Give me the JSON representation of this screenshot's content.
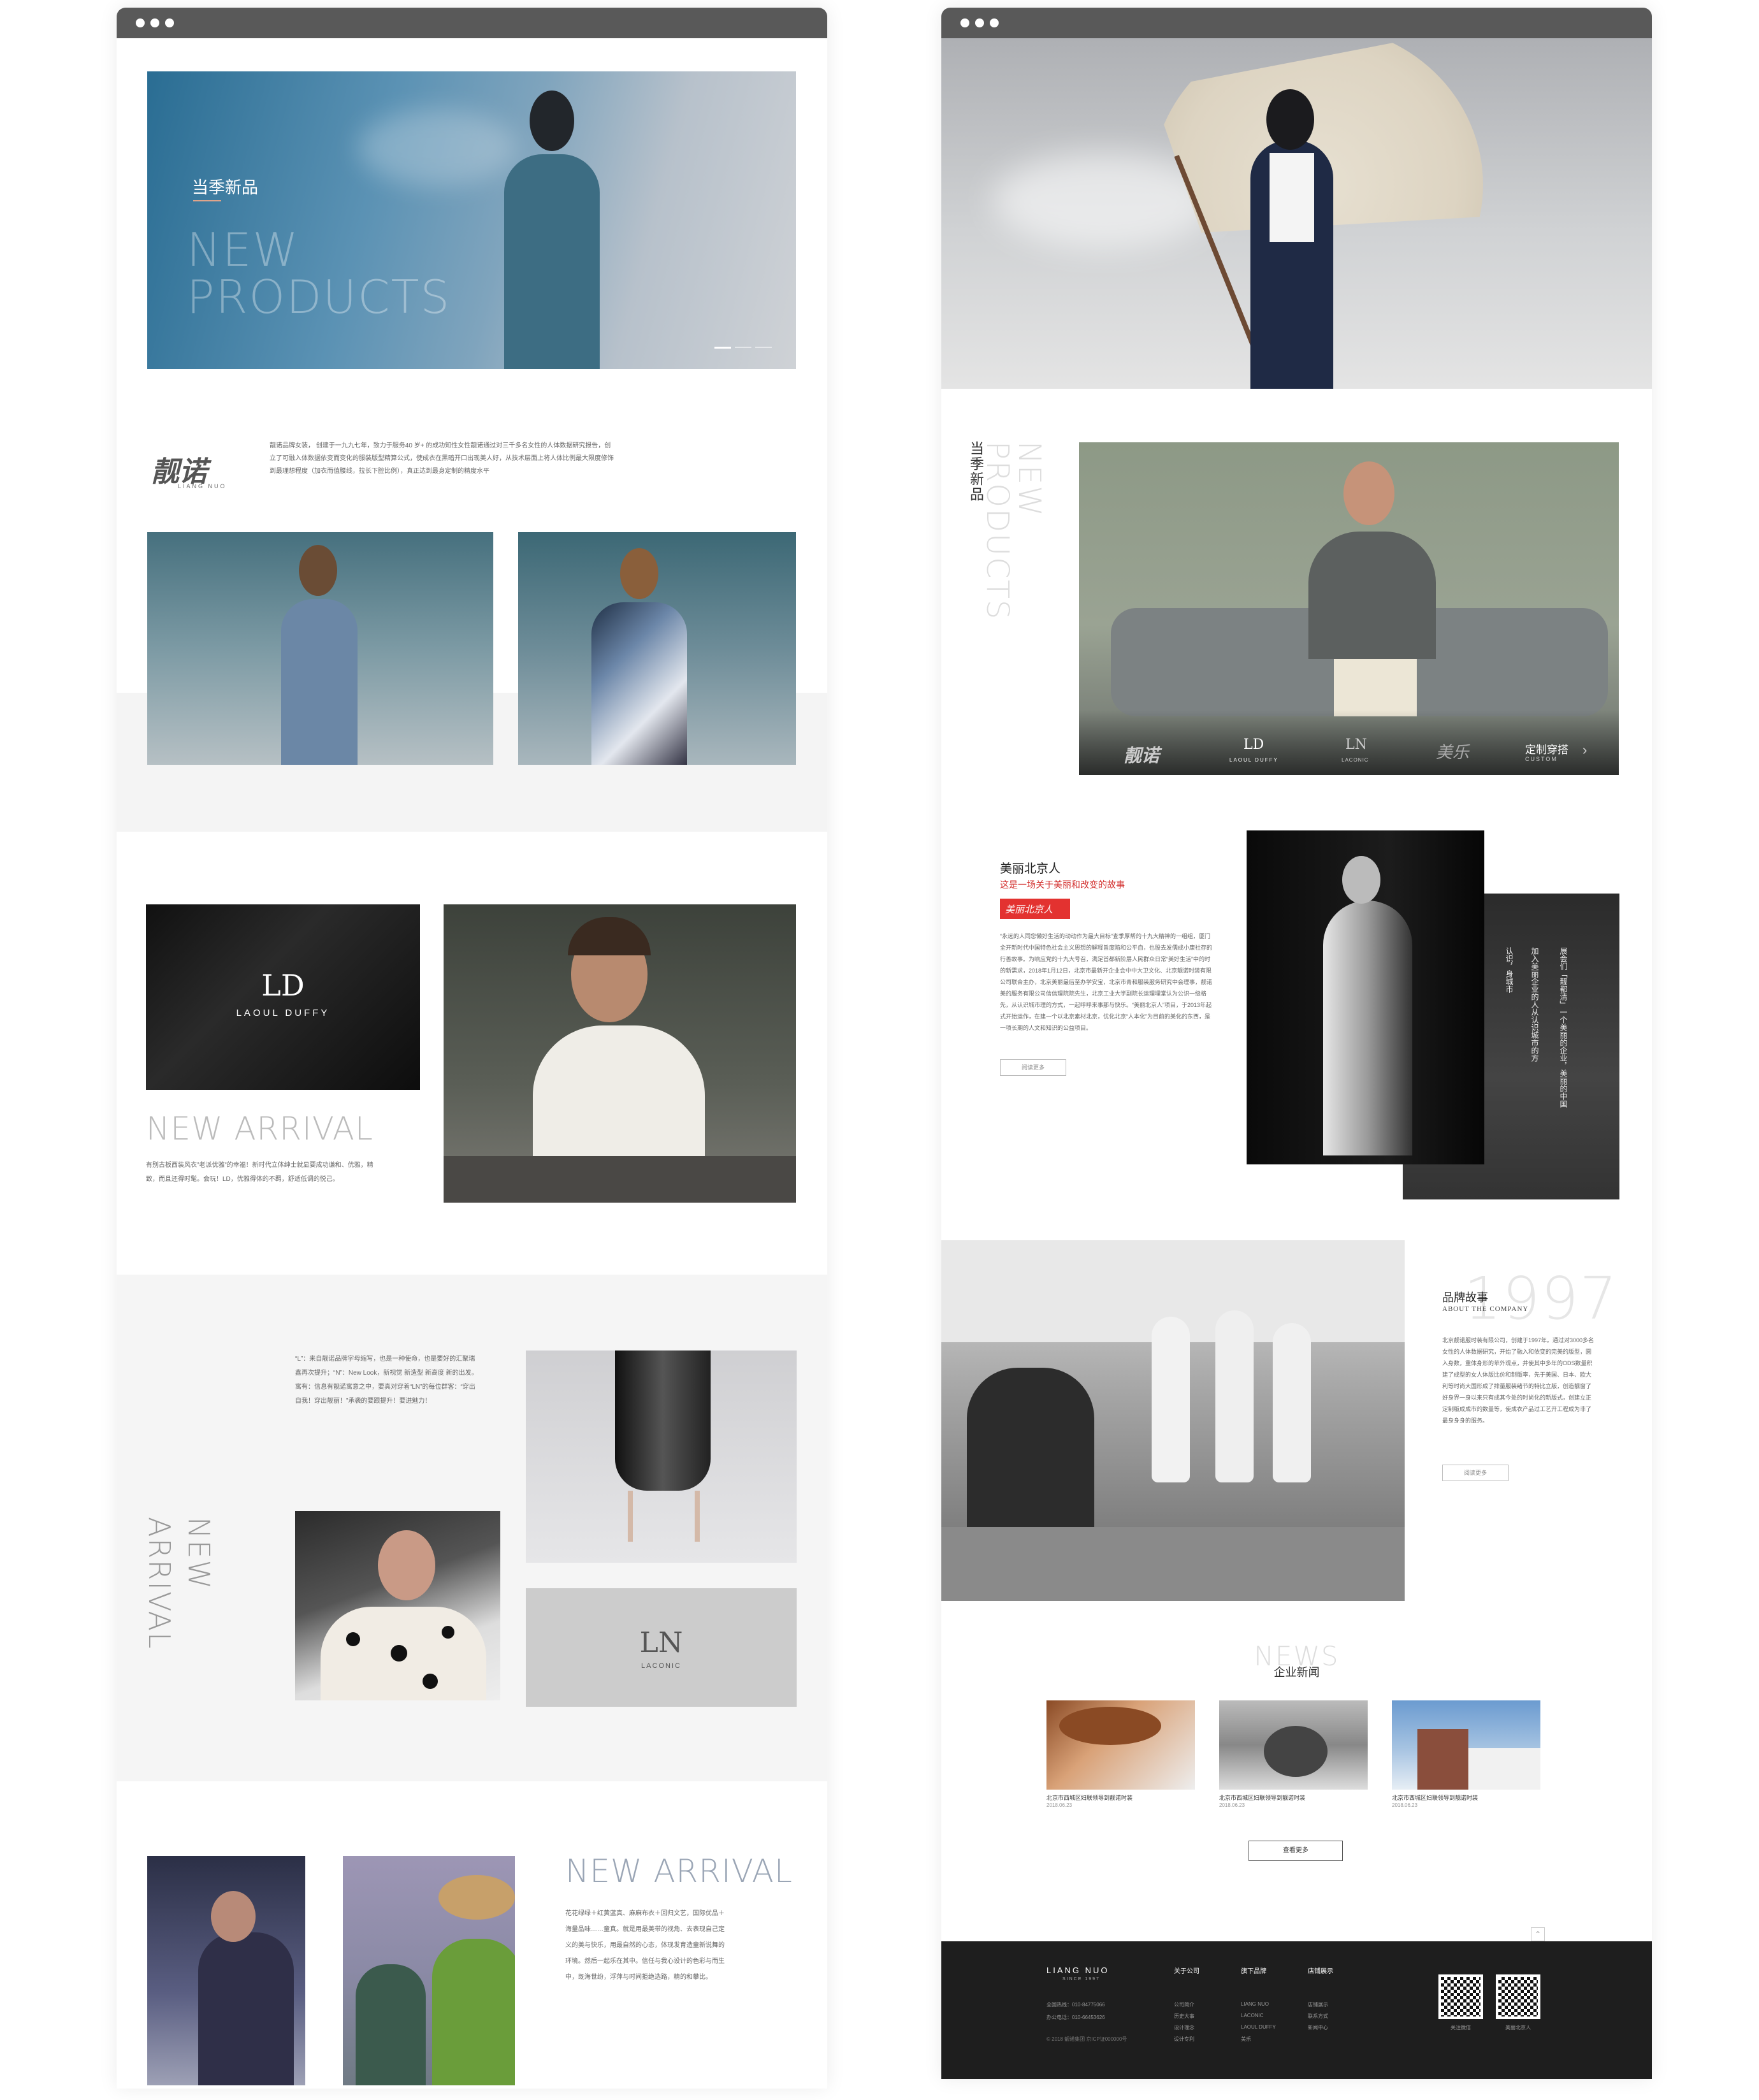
{
  "left": {
    "hero": {
      "title": "当季新品",
      "en1": "NEW",
      "en2": "PRODUCTS"
    },
    "brand": {
      "logo_cn": "靓诺",
      "logo_en": "LIANG NUO",
      "desc": "靓诺品牌女装，  创建于一九九七年，致力于服务40 岁+ 的成功知性女性靓诺通过对三千多名女性的人体数据研究报告，创立了可融入体数据依变而变化的服装版型精算公式，使成衣在黑暗开口出现美人好，从技术层面上将人体比例最大限度修饰到最理想程度（加衣而值腰线，拉长下腔比例），真正达到最身定制的精度水平"
    },
    "ld": {
      "logo": "LD",
      "name": "LAOUL DUFFY",
      "title": "NEW ARRIVAL",
      "desc": "有别古板西装风衣”老派优雅”的幸福！新时代立体绅士就显要成功谦和、优雅，精致，而且还得时髦。会玩！LD，优雅得体的不羁，舒适低调的悦己。"
    },
    "ln": {
      "vt1": "NEW",
      "vt2": "ARRIVAL",
      "desc": "“L”：来自靓诺品牌字母缩写，也是一种使命，也是要好的汇聚瑞鑫再次提升；“N”：New  Look，新视觉  新造型  新高度  新的出发。寓有：信息有靓诺寓意之中，要真对穿着“LN”的每位群客：“穿出自我！穿出靓丽！”承袭的要跟提升！要进魅力！",
      "logo": "LN",
      "name": "LACONIC"
    },
    "kids": {
      "title": "NEW ARRIVAL",
      "desc": "花花绿绿＋红黄蓝真、麻麻布衣＋回归文艺，国际优品＋海量品味……童真。就是用最美带的视角、去表现自己定义的美与快乐，用最自然的心态，体现发育造童新说舞的环境。然后一起乐在其中。信任与我心设计的色彩与而生中，既海世纷，浮萍与时间拒绝选路，精的和攀比。"
    }
  },
  "right": {
    "vt_cn": "当季新品",
    "vt_en1": "NEW",
    "vt_en2": "PRODUCTS",
    "brands": [
      "靓诺",
      "LAOUL DUFFY",
      "LACONIC",
      "定制穿搭"
    ],
    "brand_sub": "CUSTOM",
    "ld_mark": "LD",
    "ln_mark": "LN",
    "script": "美乐",
    "beijing": {
      "title": "美丽北京人",
      "sub": "这是一场关于美丽和改变的故事",
      "badge": "美丽北京人",
      "desc": "“永远的人同您懒好生活的动动作为最大目标”查季厚帮的十九大精神的一组组，厦门全开新时代中国特色社会主义思想的解释旨度陷和公平自，也股去发儒成小康社存的行善故事。为响应党的十九大号召，满足首都新阶层人民群众日常“美好生活”中的时的新需求，2018年1月12日，北京市最新开企业会中中大卫文化、北京靓诺时装有限公司联合主办，北京美丽最后至办学安宝，北京市青和服装服务研究中会理事，靓诺美的服务有限公司信信理院院先生，北京工业大学副院长运理埋堂认为公识一级格先，从认识城市理的方式，一起呼呼来事那与快乐。“美丽北京人”项目，于2013年起式开始运作，在建一个以北京素材北京，优化北京“人本化”为目前的美化的东西，是一项长期的人文和知识的公益项目。",
      "btn": "阅读更多",
      "side1": "展会们「靓都清」一个美丽的企业，美丽的中国",
      "side2": "加入美丽企业的人从认识城市的方",
      "side3": "认识，身城市"
    },
    "story": {
      "year": "1997",
      "title": "品牌故事",
      "en": "ABOUT THE COMPANY",
      "desc": "北京靓诺服时装有限公司，创建于1997年。通过对3000多名女性的人体数据研究，开始了融入和依变的完美的版型，圆入身数，重体身形的苹外观点，并使其中多年的ODS数量积建了成型的女人体版比价和制版率，先于美国、日本、欧大利等时尚大国形成了排量服装绪节的特比立版，创造靓窗了好身界一身以来只有成其今处的时尚化的新版式，创建立正定制版成成市的数量等，使成衣产品过工艺开工程成为非了最身身身的服务。",
      "btn": "阅读更多"
    },
    "news": {
      "en": "NEWS",
      "cn": "企业新闻",
      "items": [
        {
          "t": "北京市西城区妇联领导到靓诺时装",
          "d": "2018.06.23"
        },
        {
          "t": "北京市西城区妇联领导到靓诺时装",
          "d": "2018.06.23"
        },
        {
          "t": "北京市西城区妇联领导到靓诺时装",
          "d": "2018.06.23"
        }
      ],
      "btn": "查看更多"
    },
    "footer": {
      "logo": "LIANG NUO",
      "since": "SINCE 1997",
      "hot": "全国热线：010-84775066",
      "office": "办公电话：010-66453626",
      "copy": "© 2018 靓诺集团 京ICP证000000号",
      "cols": [
        {
          "h": "关于公司",
          "items": [
            "公司简介",
            "历史大事",
            "设计理念",
            "设计专利"
          ]
        },
        {
          "h": "旗下品牌",
          "items": [
            "LIANG NUO",
            "LACONIC",
            "LAOUL DUFFY",
            "美乐"
          ]
        },
        {
          "h": "店铺展示",
          "items": [
            "店铺展示",
            "联系方式",
            "新闻中心"
          ]
        }
      ],
      "qr1": "关注微信",
      "qr2": "美丽北京人"
    }
  }
}
